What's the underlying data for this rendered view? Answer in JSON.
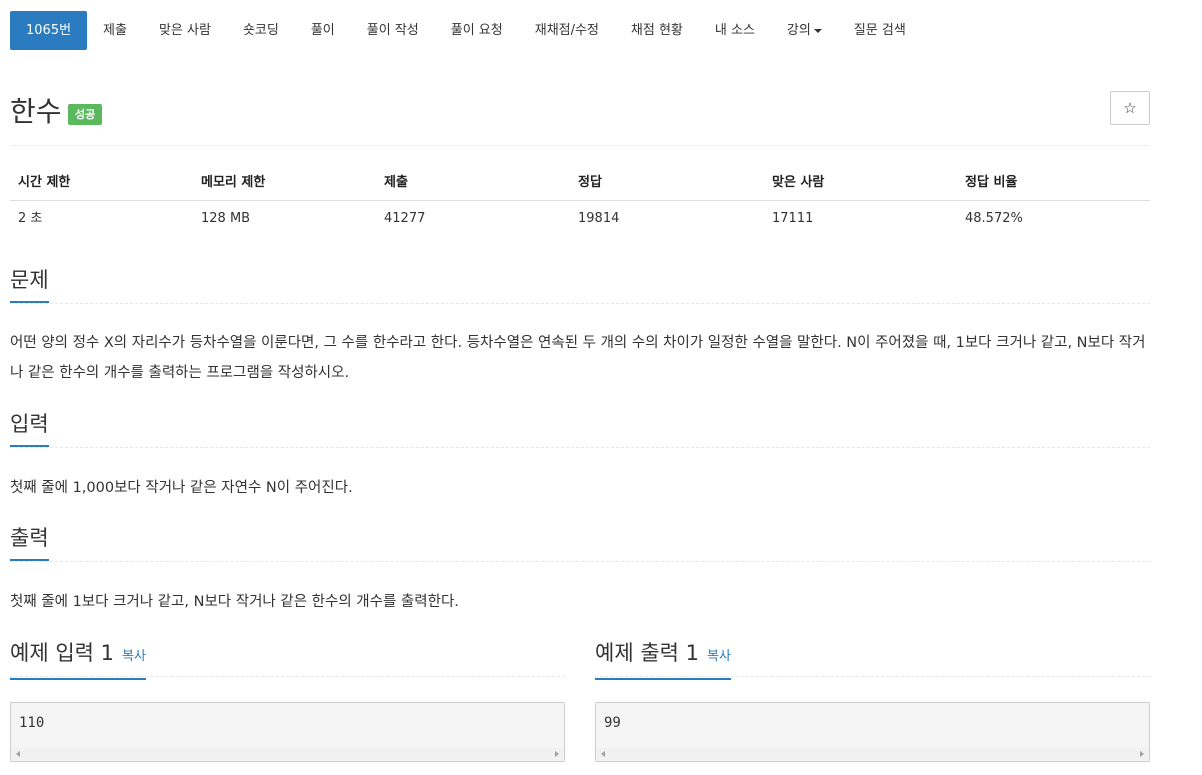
{
  "nav": {
    "items": [
      {
        "label": "1065번",
        "active": true
      },
      {
        "label": "제출"
      },
      {
        "label": "맞은 사람"
      },
      {
        "label": "숏코딩"
      },
      {
        "label": "풀이"
      },
      {
        "label": "풀이 작성"
      },
      {
        "label": "풀이 요청"
      },
      {
        "label": "재채점/수정"
      },
      {
        "label": "채점 현황"
      },
      {
        "label": "내 소스"
      },
      {
        "label": "강의",
        "dropdown": true
      },
      {
        "label": "질문 검색"
      }
    ]
  },
  "problem": {
    "title": "한수",
    "badge": "성공",
    "star_icon": "☆"
  },
  "stats": {
    "headers": [
      "시간 제한",
      "메모리 제한",
      "제출",
      "정답",
      "맞은 사람",
      "정답 비율"
    ],
    "values": [
      "2 초",
      "128 MB",
      "41277",
      "19814",
      "17111",
      "48.572%"
    ]
  },
  "sections": {
    "problem": {
      "title": "문제",
      "text": "어떤 양의 정수 X의 자리수가 등차수열을 이룬다면, 그 수를 한수라고 한다. 등차수열은 연속된 두 개의 수의 차이가 일정한 수열을 말한다. N이 주어졌을 때, 1보다 크거나 같고, N보다 작거나 같은 한수의 개수를 출력하는 프로그램을 작성하시오."
    },
    "input": {
      "title": "입력",
      "text": "첫째 줄에 1,000보다 작거나 같은 자연수 N이 주어진다."
    },
    "output": {
      "title": "출력",
      "text": "첫째 줄에 1보다 크거나 같고, N보다 작거나 같은 한수의 개수를 출력한다."
    }
  },
  "examples": {
    "input": {
      "title": "예제 입력 1",
      "copy": "복사",
      "value": "110"
    },
    "output": {
      "title": "예제 출력 1",
      "copy": "복사",
      "value": "99"
    }
  },
  "colors": {
    "accent": "#2a7bbf",
    "success": "#5cb85c"
  }
}
